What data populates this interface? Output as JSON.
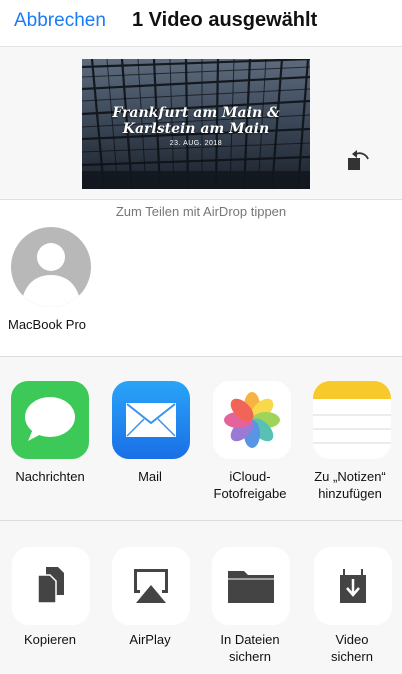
{
  "nav": {
    "cancel_label": "Abbrechen",
    "title": "1 Video ausgewählt"
  },
  "preview": {
    "title_line1": "Frankfurt am Main &",
    "title_line2": "Karlstein am Main",
    "date": "23. AUG. 2018",
    "rotate_icon": "rotate-icon"
  },
  "airdrop": {
    "hint": "Zum Teilen mit AirDrop tippen",
    "devices": [
      {
        "label": "MacBook Pro",
        "icon": "person-avatar-icon"
      }
    ]
  },
  "apps": [
    {
      "label": "Nachrichten",
      "icon": "messages-icon"
    },
    {
      "label": "Mail",
      "icon": "mail-icon"
    },
    {
      "label": "iCloud-\nFotofreigabe",
      "icon": "photos-icon"
    },
    {
      "label": "Zu „Notizen“\nhinzufügen",
      "icon": "notes-icon"
    }
  ],
  "actions": [
    {
      "label": "Kopieren",
      "icon": "copy-icon"
    },
    {
      "label": "AirPlay",
      "icon": "airplay-icon"
    },
    {
      "label": "In Dateien\nsichern",
      "icon": "folder-icon"
    },
    {
      "label": "Video\nsichern",
      "icon": "download-icon"
    }
  ],
  "colors": {
    "accent": "#1a7cf5",
    "messages_green": "#3dc957",
    "mail_blue": "#1e8ef0",
    "notes_yellow": "#f8c92a",
    "sheet_background": "#f7f7f7"
  }
}
